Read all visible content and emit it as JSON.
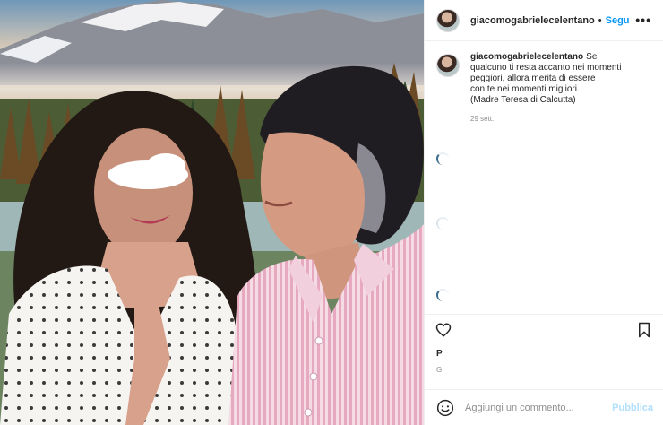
{
  "post": {
    "author": {
      "username": "giacomogabrielecelentano",
      "follow_label": "Segu",
      "separator": "•",
      "avatar_icon": "profile-avatar"
    },
    "more_label": "•••",
    "caption": {
      "username": "giacomogabrielecelentano",
      "lines": [
        "Se",
        "qualcuno ti resta accanto nei momenti",
        "peggiori, allora merita di essere",
        "con te nei momenti migliori.",
        "(Madre Teresa di Calcutta)"
      ],
      "time": "29 sett."
    },
    "likes_text": "P",
    "date_text": "GI",
    "actions": {
      "heart_icon": "heart-outline",
      "bookmark_icon": "bookmark-outline"
    },
    "comment": {
      "placeholder": "Aggiungi un commento...",
      "publish_label": "Pubblica",
      "emoji_icon": "emoji-smile"
    }
  },
  "colors": {
    "accent": "#0095f6",
    "publish_disabled": "#b2dffc",
    "secondary_text": "#8e8e8e",
    "border": "#efefef"
  }
}
